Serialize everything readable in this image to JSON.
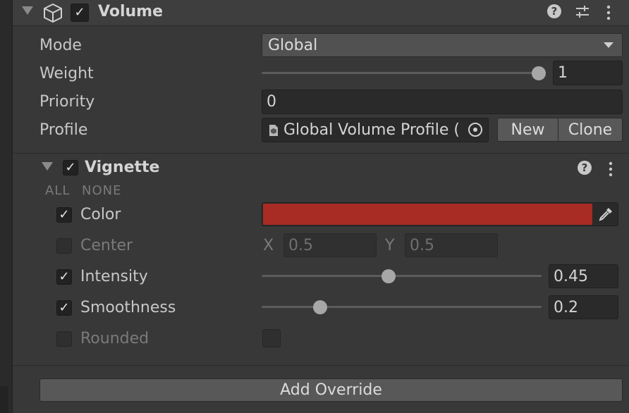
{
  "component": {
    "title": "Volume",
    "enabled": true,
    "mode_label": "Mode",
    "mode_value": "Global",
    "weight_label": "Weight",
    "weight_value": "1",
    "weight_fraction": 1.0,
    "priority_label": "Priority",
    "priority_value": "0",
    "profile_label": "Profile",
    "profile_value": "Global Volume Profile (",
    "new_button": "New",
    "clone_button": "Clone"
  },
  "vignette": {
    "title": "Vignette",
    "enabled": true,
    "all_label": "ALL",
    "none_label": "NONE",
    "color": {
      "label": "Color",
      "override": true,
      "swatch": "#a82b24"
    },
    "center": {
      "label": "Center",
      "override": false,
      "x_label": "X",
      "x_value": "0.5",
      "y_label": "Y",
      "y_value": "0.5"
    },
    "intensity": {
      "label": "Intensity",
      "override": true,
      "value": "0.45",
      "fraction": 0.45
    },
    "smoothness": {
      "label": "Smoothness",
      "override": true,
      "value": "0.2",
      "fraction": 0.2
    },
    "rounded": {
      "label": "Rounded",
      "override": false,
      "checked": false
    }
  },
  "add_override_button": "Add Override",
  "icons": [
    "foldout-arrow-icon",
    "cube-icon",
    "help-icon",
    "presets-icon",
    "kebab-menu-icon",
    "object-picker-icon",
    "eyedropper-icon",
    "profile-asset-icon"
  ]
}
